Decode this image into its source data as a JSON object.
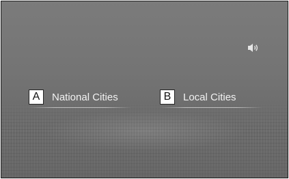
{
  "screen": {
    "background_color": "#747474",
    "voice_icon": "voice-command-icon"
  },
  "options": [
    {
      "badge": "A",
      "label": "National Cities"
    },
    {
      "badge": "B",
      "label": "Local Cities"
    }
  ]
}
